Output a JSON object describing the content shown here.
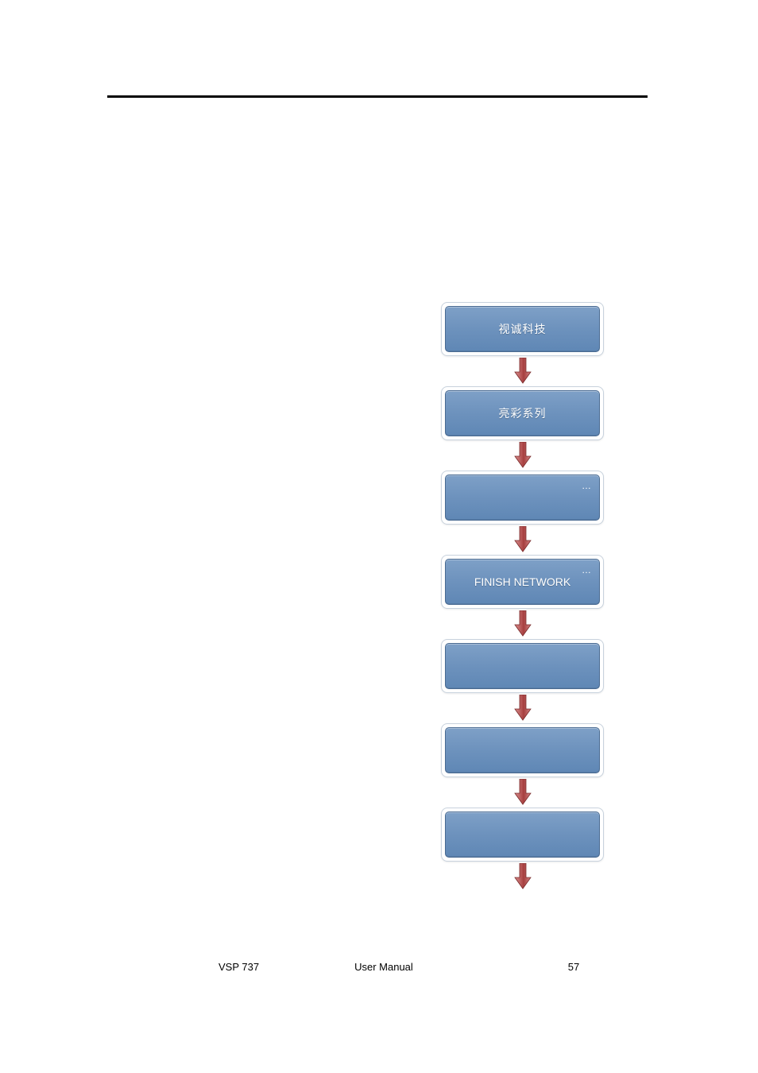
{
  "flow": {
    "nodes": [
      {
        "label": "视诚科技",
        "en": false,
        "ellipsis": false
      },
      {
        "label": "亮彩系列",
        "en": false,
        "ellipsis": false
      },
      {
        "label": "",
        "en": false,
        "ellipsis": true
      },
      {
        "label": "FINISH NETWORK",
        "en": true,
        "ellipsis": true
      },
      {
        "label": "",
        "en": false,
        "ellipsis": false
      },
      {
        "label": "",
        "en": false,
        "ellipsis": false
      },
      {
        "label": "",
        "en": false,
        "ellipsis": false
      }
    ]
  },
  "footer": {
    "left": "VSP 737",
    "center": "User Manual",
    "page": "57"
  }
}
